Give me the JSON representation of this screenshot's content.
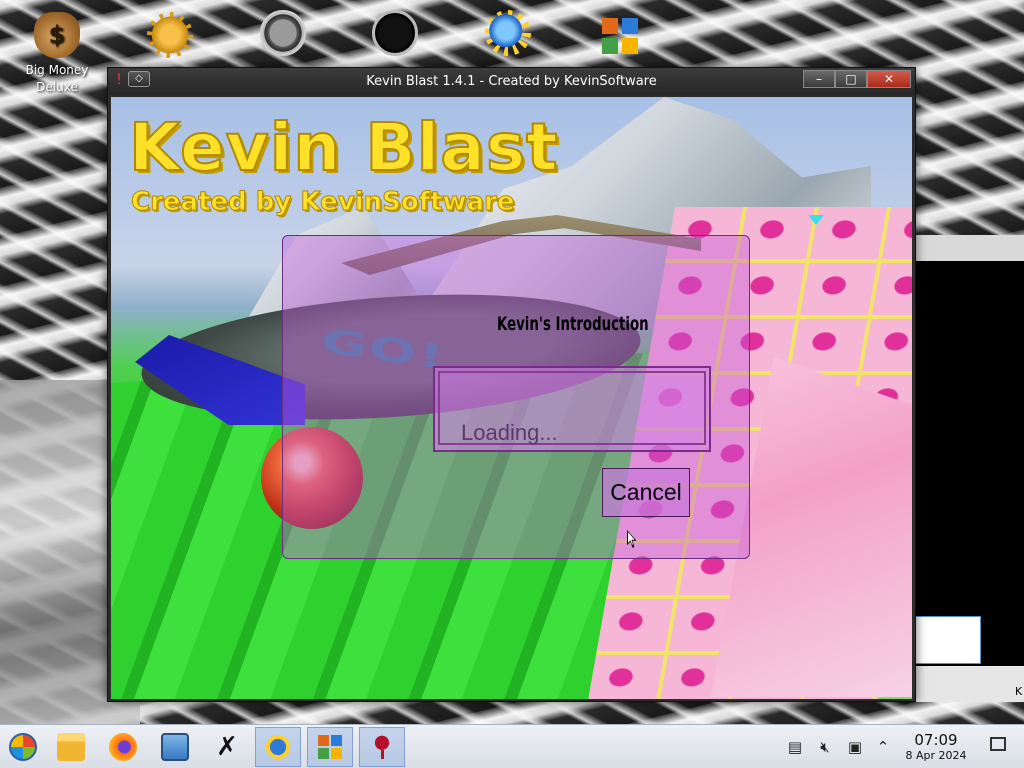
{
  "desktop": {
    "icons": [
      {
        "label": "Big Money\nDeluxe",
        "icon": "money-bag-icon"
      },
      {
        "label": "",
        "icon": "gear-icon"
      },
      {
        "label": "",
        "icon": "gauge-icon"
      },
      {
        "label": "",
        "icon": "red-disc-icon"
      },
      {
        "label": "",
        "icon": "kevin-blast-icon"
      },
      {
        "label": "",
        "icon": "office-grid-icon"
      }
    ]
  },
  "window": {
    "title": "Kevin Blast 1.4.1 - Created by KevinSoftware",
    "controls": {
      "minimize": "–",
      "maximize": "□",
      "close": "✕"
    },
    "pin_glyph": "!",
    "menu_glyph": "◇"
  },
  "game": {
    "logo_title": "Kevin Blast",
    "logo_subtitle": "Created by KevinSoftware",
    "floor_text": "GO!"
  },
  "dialog": {
    "title": "Kevin's Introduction",
    "loading_text": "Loading...",
    "cancel_label": "Cancel"
  },
  "background_window": {
    "footer_text": "K"
  },
  "taskbar": {
    "apps": [
      {
        "name": "start",
        "icon": "start-orb-icon",
        "active": false
      },
      {
        "name": "files",
        "icon": "folder-icon",
        "active": false
      },
      {
        "name": "firefox",
        "icon": "firefox-icon",
        "active": false
      },
      {
        "name": "monitor",
        "icon": "monitor-icon",
        "active": false
      },
      {
        "name": "xtool",
        "icon": "x-tool-icon",
        "active": false
      },
      {
        "name": "kevin-blast",
        "icon": "kevin-blast-icon",
        "active": true
      },
      {
        "name": "office",
        "icon": "office-grid-icon",
        "active": true
      },
      {
        "name": "wine",
        "icon": "wine-glass-icon",
        "active": true
      }
    ],
    "clock_time": "07:09",
    "clock_date": "8 Apr 2024"
  },
  "colors": {
    "logo_yellow": "#ffe12a",
    "dialog_purple": "#c45adc",
    "taskbar_bg": "#e3e7ee"
  }
}
